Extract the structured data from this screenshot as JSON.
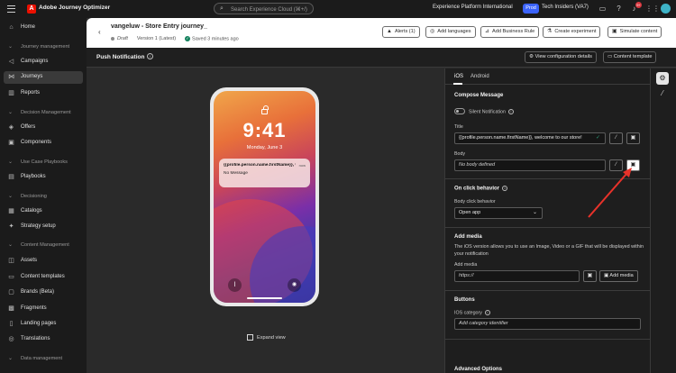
{
  "app": {
    "name": "Adobe Journey Optimizer",
    "logo_letter": "A",
    "search_placeholder": "Search Experience Cloud (⌘+/)",
    "org": "Experience Platform International",
    "env_badge": "Prod",
    "sandbox": "Tech Insiders (VA7)",
    "notif_count": "9+"
  },
  "nav": {
    "home": "Home",
    "sec_journey": "Journey management",
    "campaigns": "Campaigns",
    "journeys": "Journeys",
    "reports": "Reports",
    "sec_decision": "Decision Management",
    "offers": "Offers",
    "components": "Components",
    "sec_usecase": "Use Case Playbooks",
    "playbooks": "Playbooks",
    "sec_decisioning": "Decisioning",
    "catalogs": "Catalogs",
    "strategy": "Strategy setup",
    "sec_content": "Content Management",
    "assets": "Assets",
    "content_templates": "Content templates",
    "brands": "Brands (Beta)",
    "fragments": "Fragments",
    "landing_pages": "Landing pages",
    "translations": "Translations",
    "sec_data": "Data management"
  },
  "header": {
    "title": "vangeluw - Store Entry journey_",
    "status": "Draft",
    "version": "Version 1 (Latest)",
    "saved": "Saved 3 minutes ago",
    "alerts": "Alerts (1)",
    "add_languages": "Add languages",
    "add_business_rule": "Add Business Rule",
    "create_experiment": "Create experiment",
    "simulate": "Simulate content"
  },
  "subheader": {
    "title": "Push Notification",
    "view_config": "View configuration details",
    "content_template": "Content template"
  },
  "preview": {
    "time": "9:41",
    "date": "Monday, June 3",
    "notif_title": "{{profile.person.name.firstName}}, we...",
    "notif_time": "now",
    "notif_body": "No Message",
    "expand": "Expand view"
  },
  "panel": {
    "tab_ios": "iOS",
    "tab_android": "Android",
    "compose": "Compose Message",
    "silent": "Silent Notification",
    "title_label": "Title",
    "title_value": "{{profile.person.name.firstName}}, welcome to our store!",
    "body_label": "Body",
    "body_placeholder": "No body defined",
    "onclick_title": "On click behavior",
    "body_click_label": "Body click behavior",
    "body_click_value": "Open app",
    "add_media_title": "Add media",
    "add_media_desc": "The iOS version allows you to use an Image, Video or a GIF that will be displayed within your notification",
    "add_media_label": "Add media",
    "add_media_value": "https://",
    "add_media_btn": "Add media",
    "buttons_title": "Buttons",
    "ios_category_label": "IOS category",
    "ios_category_placeholder": "Add category identifier",
    "advanced": "Advanced Options"
  },
  "colors": {
    "accent": "#3b63fb",
    "annotation_arrow": "#e8322a",
    "brand": "#eb1000"
  }
}
